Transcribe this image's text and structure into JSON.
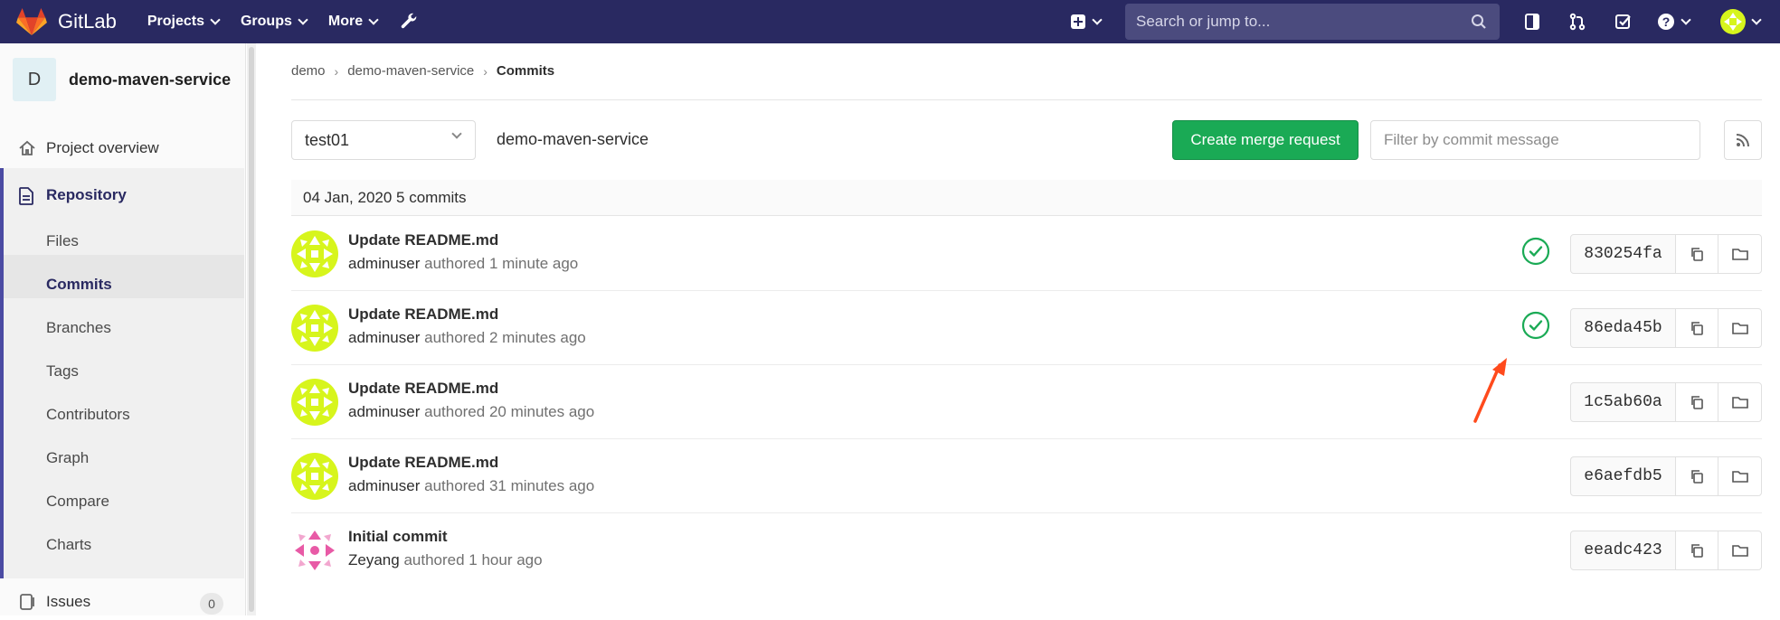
{
  "topnav": {
    "brand": "GitLab",
    "menu": [
      {
        "label": "Projects"
      },
      {
        "label": "Groups"
      },
      {
        "label": "More"
      }
    ],
    "search_placeholder": "Search or jump to...",
    "colors": {
      "bar": "#292961",
      "search_bg": "#4b4b7e"
    }
  },
  "sidebar": {
    "project_initial": "D",
    "project_name": "demo-maven-service",
    "overview_label": "Project overview",
    "repository_label": "Repository",
    "repository_items": [
      "Files",
      "Commits",
      "Branches",
      "Tags",
      "Contributors",
      "Graph",
      "Compare",
      "Charts"
    ],
    "active_item": "Commits",
    "issues_label": "Issues",
    "issues_count": "0"
  },
  "breadcrumb": [
    "demo",
    "demo-maven-service",
    "Commits"
  ],
  "toolbar": {
    "branch": "test01",
    "path": "demo-maven-service",
    "create_merge_request": "Create merge request",
    "filter_placeholder": "Filter by commit message"
  },
  "day_group": {
    "header": "04 Jan, 2020 5 commits"
  },
  "commits": [
    {
      "title": "Update README.md",
      "author": "adminuser",
      "authored_text": "authored 1 minute ago",
      "sha": "830254fa",
      "status": "passed",
      "avatar": "lime"
    },
    {
      "title": "Update README.md",
      "author": "adminuser",
      "authored_text": "authored 2 minutes ago",
      "sha": "86eda45b",
      "status": "passed",
      "avatar": "lime"
    },
    {
      "title": "Update README.md",
      "author": "adminuser",
      "authored_text": "authored 20 minutes ago",
      "sha": "1c5ab60a",
      "status": "",
      "avatar": "lime"
    },
    {
      "title": "Update README.md",
      "author": "adminuser",
      "authored_text": "authored 31 minutes ago",
      "sha": "e6aefdb5",
      "status": "",
      "avatar": "lime"
    },
    {
      "title": "Initial commit",
      "author": "Zeyang",
      "authored_text": "authored 1 hour ago",
      "sha": "eeadc423",
      "status": "",
      "avatar": "pink"
    }
  ],
  "colors": {
    "accent_green": "#1aaa55",
    "pipeline_passed": "#1aaa55",
    "annotation_arrow": "#ff4a1c",
    "repo_active_border": "#4b4ba3"
  }
}
